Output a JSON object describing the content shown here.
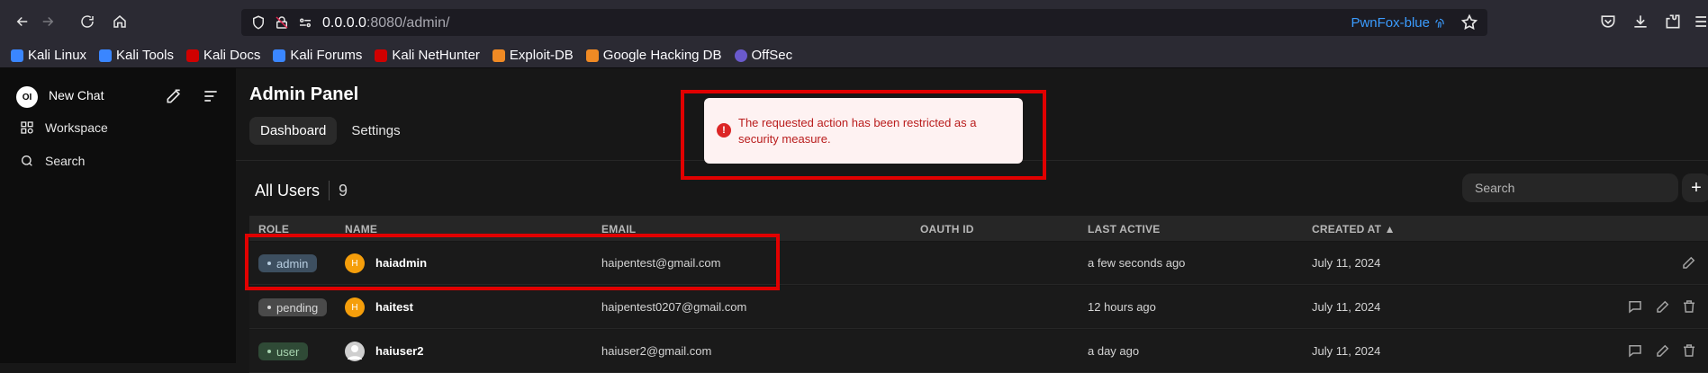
{
  "browser": {
    "url_host": "0.0.0.0",
    "url_port": ":8080",
    "url_path": "/admin/",
    "pwnfox": "PwnFox-blue"
  },
  "bookmarks": [
    {
      "label": "Kali Linux",
      "color": "#3a86ff"
    },
    {
      "label": "Kali Tools",
      "color": "#3a86ff"
    },
    {
      "label": "Kali Docs",
      "color": "#d00000"
    },
    {
      "label": "Kali Forums",
      "color": "#3a86ff"
    },
    {
      "label": "Kali NetHunter",
      "color": "#d00000"
    },
    {
      "label": "Exploit-DB",
      "color": "#f08a24"
    },
    {
      "label": "Google Hacking DB",
      "color": "#f08a24"
    },
    {
      "label": "OffSec",
      "color": "#6a5acd"
    }
  ],
  "sidebar": {
    "logo": "OI",
    "new_chat": "New Chat",
    "workspace": "Workspace",
    "search": "Search"
  },
  "main": {
    "title": "Admin Panel",
    "tabs": [
      "Dashboard",
      "Settings"
    ],
    "users_title": "All Users",
    "users_count": "9",
    "search_placeholder": "Search",
    "add_symbol": "+"
  },
  "table": {
    "headers": [
      "ROLE",
      "NAME",
      "EMAIL",
      "OAUTH ID",
      "LAST ACTIVE",
      "CREATED AT ▲"
    ],
    "rows": [
      {
        "role": "admin",
        "initial": "H",
        "name": "haiadmin",
        "email": "haipentest@gmail.com",
        "last_active": "a few seconds ago",
        "created": "July 11, 2024"
      },
      {
        "role": "pending",
        "initial": "H",
        "name": "haitest",
        "email": "haipentest0207@gmail.com",
        "last_active": "12 hours ago",
        "created": "July 11, 2024"
      },
      {
        "role": "user",
        "initial": "",
        "name": "haiuser2",
        "email": "haiuser2@gmail.com",
        "last_active": "a day ago",
        "created": "July 11, 2024"
      }
    ]
  },
  "toast": {
    "icon": "!",
    "message": "The requested action has been restricted as a security measure."
  },
  "colors": {
    "highlight": "#e10000",
    "toast_text": "#b91c1c",
    "accent_link": "#3b9cff"
  }
}
